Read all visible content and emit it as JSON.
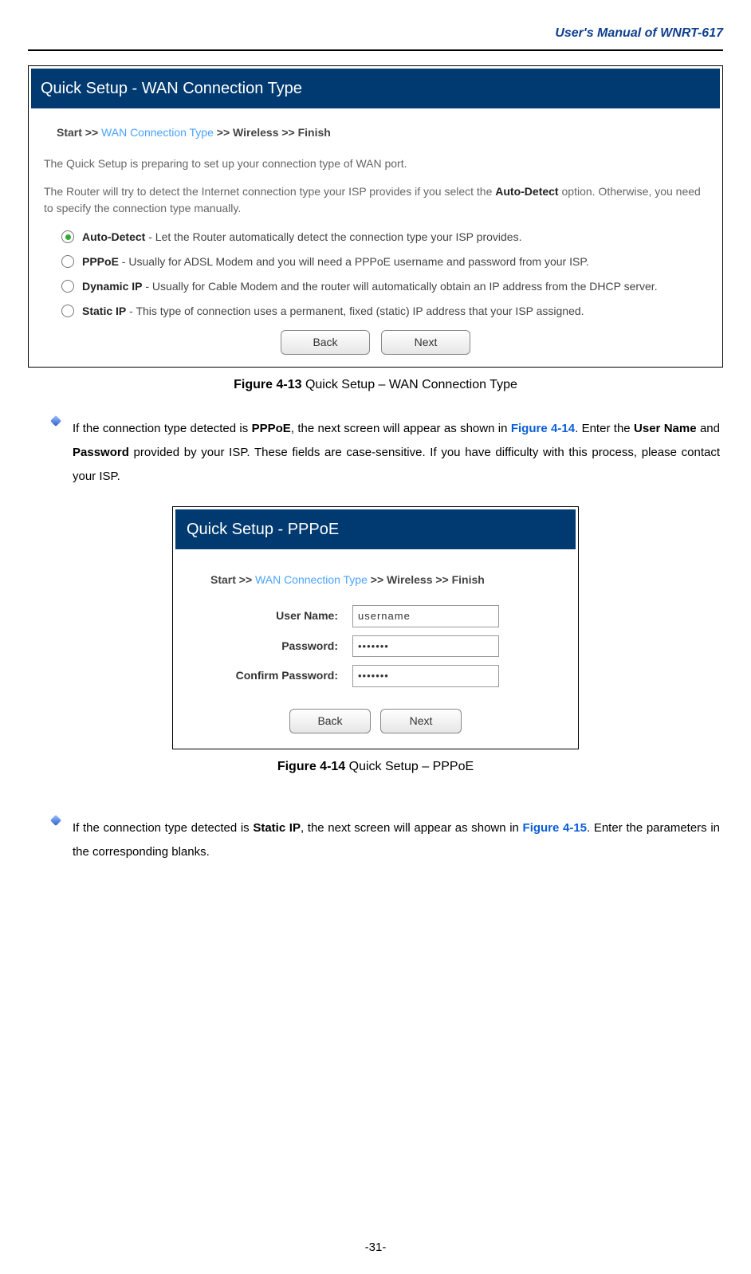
{
  "header": {
    "title": "User's Manual of WNRT-617"
  },
  "shot1": {
    "title": "Quick Setup - WAN Connection Type",
    "bcStart": "Start >> ",
    "bcActive": "WAN Connection Type",
    "bcRest": " >> Wireless >> Finish",
    "line1": "The Quick Setup is preparing to set up your connection type of WAN port.",
    "line2a": "The Router will try to detect the Internet connection type your ISP provides if you select the ",
    "line2bold": "Auto-Detect",
    "line2b": " option. Otherwise, you need to specify the connection type manually.",
    "opts": [
      {
        "name": "Auto-Detect",
        "desc": " - Let the Router automatically detect the connection type your ISP provides.",
        "sel": true
      },
      {
        "name": "PPPoE",
        "desc": " - Usually for ADSL Modem and you will need a PPPoE username and password from your ISP.",
        "sel": false
      },
      {
        "name": "Dynamic IP",
        "desc": " - Usually for Cable Modem and the router will automatically obtain an IP address from the DHCP server.",
        "sel": false
      },
      {
        "name": "Static IP",
        "desc": " - This type of connection uses a permanent, fixed (static) IP address that your ISP assigned.",
        "sel": false
      }
    ],
    "btnBack": "Back",
    "btnNext": "Next"
  },
  "caption1": {
    "fig": "Figure 4-13",
    "text": "    Quick Setup – WAN Connection Type"
  },
  "para1": {
    "p1": "If the connection type detected is ",
    "b1": "PPPoE",
    "p2": ", the next screen will appear as shown in ",
    "ref": "Figure 4-14",
    "p3": ". Enter the ",
    "b2": "User Name",
    "p4": " and ",
    "b3": "Password",
    "p5": " provided by your ISP. These fields are case-sensitive. If you have difficulty with this process, please contact your ISP."
  },
  "shot2": {
    "title": "Quick Setup - PPPoE",
    "bcStart": "Start >> ",
    "bcActive": "WAN Connection Type",
    "bcRest": " >> Wireless >> Finish",
    "lblUser": "User Name:",
    "valUser": "username",
    "lblPass": "Password:",
    "valPass": "•••••••",
    "lblConfirm": "Confirm Password:",
    "valConfirm": "•••••••",
    "btnBack": "Back",
    "btnNext": "Next"
  },
  "caption2": {
    "fig": "Figure 4-14",
    "text": "    Quick Setup – PPPoE"
  },
  "para2": {
    "p1": "If the connection type detected is ",
    "b1": "Static IP",
    "p2": ", the next screen will appear as shown in ",
    "ref": "Figure 4-15",
    "p3": ". Enter the parameters in the corresponding blanks."
  },
  "pageNum": "-31-"
}
